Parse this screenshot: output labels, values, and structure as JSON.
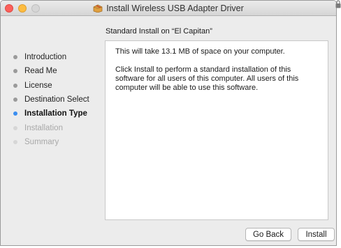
{
  "window": {
    "title": "Install Wireless USB Adapter Driver",
    "icon": "package-icon"
  },
  "subheader": "Standard Install on “El Capitan”",
  "sidebar": {
    "items": [
      {
        "label": "Introduction",
        "state": "done"
      },
      {
        "label": "Read Me",
        "state": "done"
      },
      {
        "label": "License",
        "state": "done"
      },
      {
        "label": "Destination Select",
        "state": "done"
      },
      {
        "label": "Installation Type",
        "state": "current"
      },
      {
        "label": "Installation",
        "state": "todo"
      },
      {
        "label": "Summary",
        "state": "todo"
      }
    ]
  },
  "content": {
    "paragraph1": "This will take 13.1 MB of space on your computer.",
    "paragraph2": "Click Install to perform a standard installation of this software for all users of this computer. All users of this computer will be able to use this software."
  },
  "buttons": {
    "back": "Go Back",
    "install": "Install"
  },
  "colors": {
    "accent": "#3b8ef0",
    "close": "#fc605b",
    "minimize": "#fdbc40"
  }
}
